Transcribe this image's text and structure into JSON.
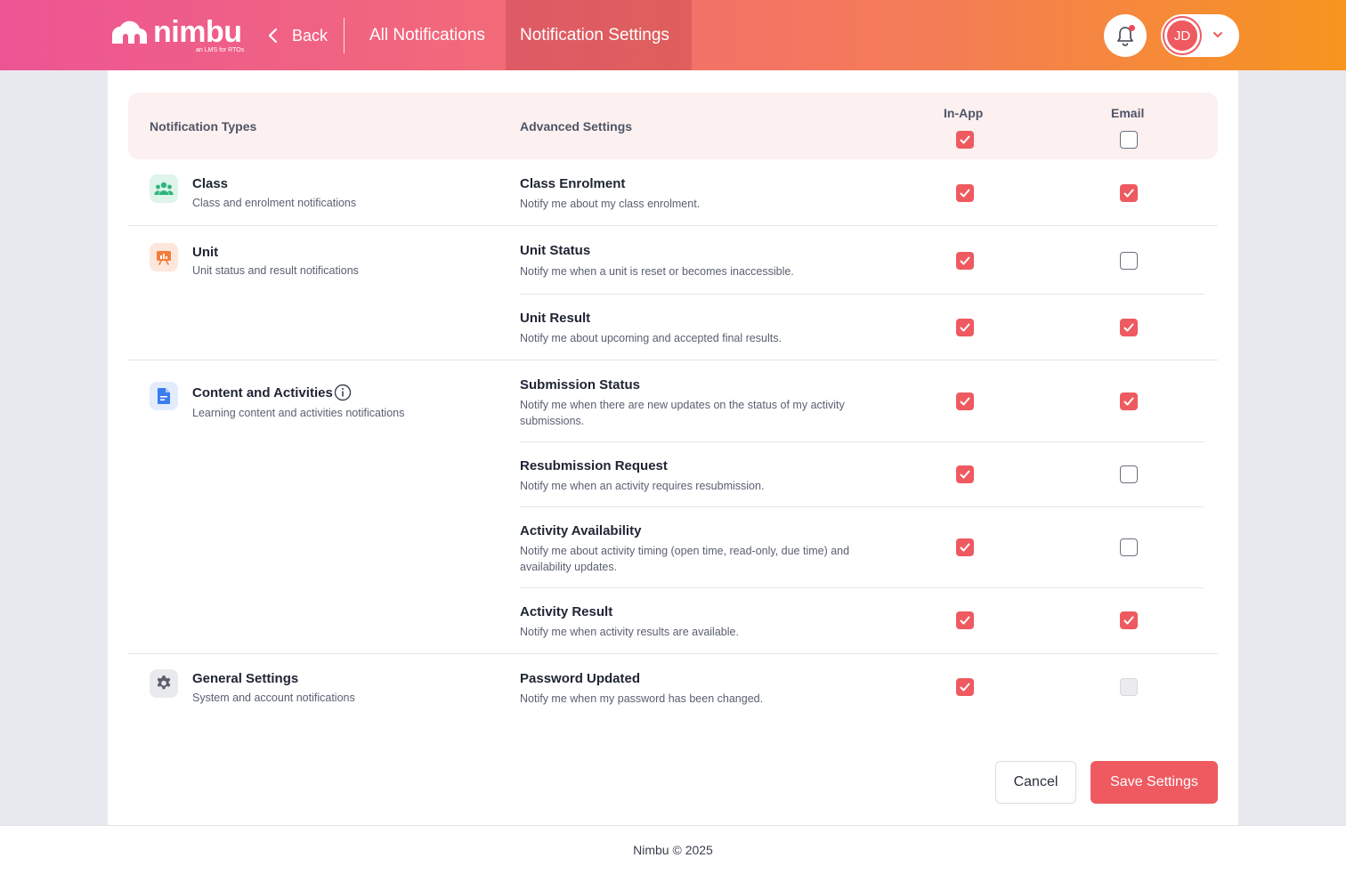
{
  "header": {
    "logo_text": "nimbu",
    "logo_tagline": "an LMS for RTOs",
    "back_label": "Back",
    "tabs": [
      {
        "label": "All Notifications",
        "active": false
      },
      {
        "label": "Notification Settings",
        "active": true
      }
    ],
    "user_initials": "JD",
    "has_unread": true
  },
  "table": {
    "col_types": "Notification Types",
    "col_advanced": "Advanced Settings",
    "col_inapp": "In-App",
    "col_email": "Email",
    "all_inapp_checked": true,
    "all_email_checked": false
  },
  "categories": [
    {
      "icon": "users-icon",
      "title": "Class",
      "description": "Class and enrolment notifications"
    },
    {
      "icon": "presentation-chart-icon",
      "title": "Unit",
      "description": "Unit status and result notifications"
    },
    {
      "icon": "document-icon",
      "title": "Content and Activities",
      "description": "Learning content and activities notifications"
    },
    {
      "icon": "gear-icon",
      "title": "General Settings",
      "description": "System and account notifications"
    }
  ],
  "settings": [
    {
      "title": "Class Enrolment",
      "description": "Notify me about my class enrolment.",
      "in_app": true,
      "email": true
    },
    {
      "title": "Unit Status",
      "description": "Notify me when a unit is reset or becomes inaccessible.",
      "in_app": true,
      "email": false
    },
    {
      "title": "Unit Result",
      "description": "Notify me about upcoming and accepted final results.",
      "in_app": true,
      "email": true
    },
    {
      "title": "Submission Status",
      "description": "Notify me when there are new updates on the status of my activity submissions.",
      "in_app": true,
      "email": true
    },
    {
      "title": "Resubmission Request",
      "description": "Notify me when an activity requires resubmission.",
      "in_app": true,
      "email": false
    },
    {
      "title": "Activity Availability",
      "description": "Notify me about activity timing (open time, read-only, due time) and availability updates.",
      "in_app": true,
      "email": false
    },
    {
      "title": "Activity Result",
      "description": "Notify me when activity results are available.",
      "in_app": true,
      "email": true
    },
    {
      "title": "Password Updated",
      "description": "Notify me when my password has been changed.",
      "in_app": true,
      "email": false,
      "email_disabled": true
    }
  ],
  "actions": {
    "cancel_label": "Cancel",
    "save_label": "Save Settings"
  },
  "footer": {
    "text": "Nimbu © 2025"
  },
  "colors": {
    "accent": "#ee5a60",
    "header_start": "#ec5594",
    "header_end": "#f7951f"
  }
}
